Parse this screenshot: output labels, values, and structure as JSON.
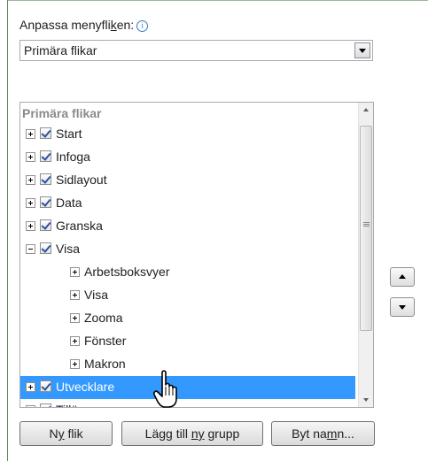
{
  "label": {
    "pre": "Anpassa menyfli",
    "access": "k",
    "post": "en:",
    "info_icon": "info-circle-icon",
    "info_glyph": "i"
  },
  "dropdown": {
    "value": "Primära flikar"
  },
  "tree": {
    "header": "Primära flikar",
    "items": [
      {
        "label": "Start",
        "expanded": false,
        "checked": true
      },
      {
        "label": "Infoga",
        "expanded": false,
        "checked": true
      },
      {
        "label": "Sidlayout",
        "expanded": false,
        "checked": true
      },
      {
        "label": "Data",
        "expanded": false,
        "checked": true
      },
      {
        "label": "Granska",
        "expanded": false,
        "checked": true
      },
      {
        "label": "Visa",
        "expanded": true,
        "checked": true
      },
      {
        "label": "Arbetsboksvyer",
        "child": true
      },
      {
        "label": "Visa",
        "child": true
      },
      {
        "label": "Zooma",
        "child": true
      },
      {
        "label": "Fönster",
        "child": true
      },
      {
        "label": "Makron",
        "child": true
      },
      {
        "label": "Utvecklare",
        "expanded": false,
        "checked": true,
        "selected": true
      },
      {
        "label": "Tillägg",
        "expanded": false,
        "checked": true
      }
    ]
  },
  "buttons": {
    "new_tab": {
      "pre": "N",
      "access": "y",
      "post": " flik"
    },
    "add_group": {
      "pre": "Lägg till ",
      "access": "ny",
      "post": " grupp"
    },
    "rename": {
      "pre": "Byt na",
      "access": "m",
      "post": "n..."
    }
  },
  "colors": {
    "selection": "#3399ff",
    "checkmark": "#2b51a0",
    "frame": "#5a8a5a"
  },
  "icons": {
    "move_up": "triangle-up-icon",
    "move_down": "triangle-down-icon",
    "cursor": "hand-pointer-icon"
  }
}
